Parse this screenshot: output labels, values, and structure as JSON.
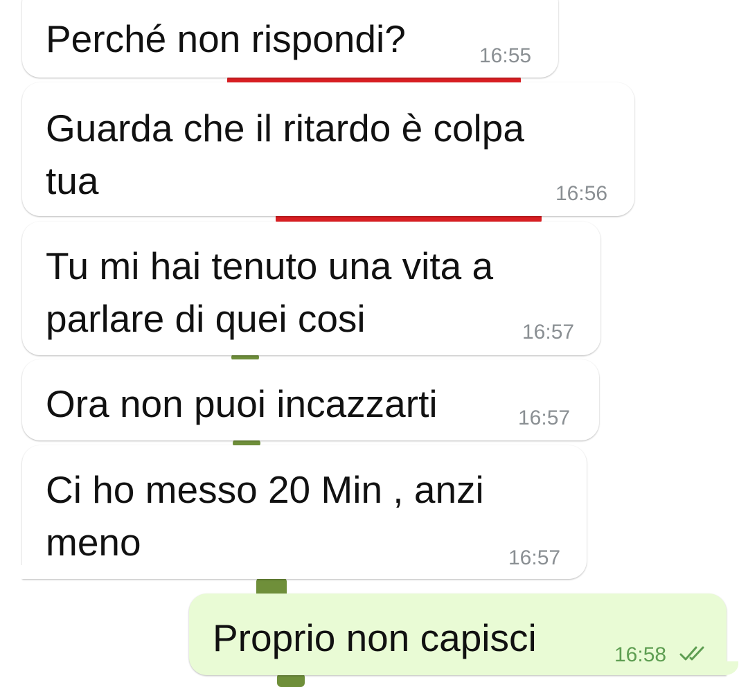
{
  "messages": [
    {
      "direction": "incoming",
      "text": "Perché non rispondi?",
      "time": "16:55"
    },
    {
      "direction": "incoming",
      "text": "Guarda che il ritardo è colpa\ntua",
      "time": "16:56"
    },
    {
      "direction": "incoming",
      "text": "Tu mi hai tenuto una vita a\nparlare di quei cosi",
      "time": "16:57"
    },
    {
      "direction": "incoming",
      "text": "Ora non puoi incazzarti",
      "time": "16:57"
    },
    {
      "direction": "incoming",
      "text": "Ci ho messo 20 Min , anzi\nmeno",
      "time": "16:57"
    },
    {
      "direction": "outgoing",
      "text": "Proprio non capisci",
      "time": "16:58",
      "status": "double-check-read-icon"
    }
  ],
  "colors": {
    "incoming_bubble": "#ffffff",
    "outgoing_bubble": "#e9fbd5",
    "timestamp_incoming": "#8a8f93",
    "timestamp_outgoing": "#5e9e52",
    "read_ticks": "#5e9e52"
  }
}
